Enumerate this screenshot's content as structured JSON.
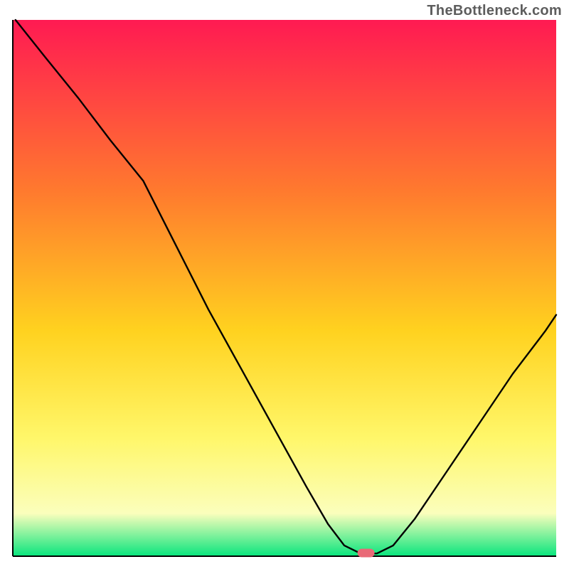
{
  "watermark": "TheBottleneck.com",
  "chart_data": {
    "type": "line",
    "title": "",
    "xlabel": "",
    "ylabel": "",
    "xlim": [
      0,
      100
    ],
    "ylim": [
      0,
      100
    ],
    "legend": false,
    "grid": false,
    "background_gradient": {
      "top": "#ff1a52",
      "upper_mid": "#ff7a2e",
      "mid": "#ffd21f",
      "lower_mid": "#fff76a",
      "pale_band": "#fbfebc",
      "bottom": "#09e57d"
    },
    "marker": {
      "x": 65,
      "y": 0.6,
      "color": "#e96a77",
      "shape": "pill"
    },
    "series": [
      {
        "name": "curve",
        "stroke": "#000000",
        "x": [
          0.5,
          6,
          12,
          18,
          24,
          30,
          36,
          42,
          48,
          54,
          58,
          61,
          64,
          67,
          70,
          74,
          80,
          86,
          92,
          98,
          100
        ],
        "y": [
          100,
          93,
          85.5,
          77.5,
          70,
          58,
          46,
          35,
          24,
          13,
          6,
          2,
          0.5,
          0.5,
          2,
          7,
          16,
          25,
          34,
          42,
          45
        ]
      }
    ]
  }
}
